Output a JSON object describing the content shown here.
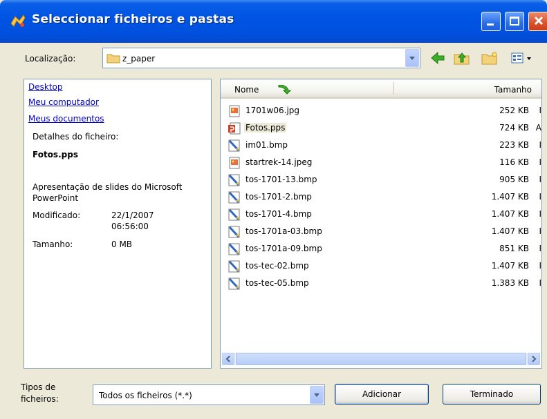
{
  "window": {
    "title": "Seleccionar ficheiros e pastas"
  },
  "location": {
    "label": "Localização:",
    "value": "z_paper"
  },
  "left_panel": {
    "places": [
      "Desktop",
      "Meu computador",
      "Meus documentos"
    ],
    "details_heading": "Detalhes do ficheiro:",
    "file_name": "Fotos.pps",
    "file_type": "Apresentação de slides do Microsoft PowerPoint",
    "modified_label": "Modificado:",
    "modified_date": "22/1/2007",
    "modified_time": "06:56:00",
    "size_label": "Tamanho:",
    "size_value": "0 MB"
  },
  "file_list": {
    "col_name": "Nome",
    "col_size": "Tamanho",
    "files": [
      {
        "name": "1701w06.jpg",
        "size": "252 KB",
        "icon": "image-file-icon",
        "trunc": "I"
      },
      {
        "name": "Fotos.pps",
        "size": "724 KB",
        "icon": "powerpoint-file-icon",
        "trunc": "A"
      },
      {
        "name": "im01.bmp",
        "size": "223 KB",
        "icon": "bitmap-file-icon",
        "trunc": "I"
      },
      {
        "name": "startrek-14.jpeg",
        "size": "116 KB",
        "icon": "image-file-icon",
        "trunc": "I"
      },
      {
        "name": "tos-1701-13.bmp",
        "size": "905 KB",
        "icon": "bitmap-file-icon",
        "trunc": "I"
      },
      {
        "name": "tos-1701-2.bmp",
        "size": "1.407 KB",
        "icon": "bitmap-file-icon",
        "trunc": "I"
      },
      {
        "name": "tos-1701-4.bmp",
        "size": "1.407 KB",
        "icon": "bitmap-file-icon",
        "trunc": "I"
      },
      {
        "name": "tos-1701a-03.bmp",
        "size": "1.407 KB",
        "icon": "bitmap-file-icon",
        "trunc": "I"
      },
      {
        "name": "tos-1701a-09.bmp",
        "size": "851 KB",
        "icon": "bitmap-file-icon",
        "trunc": "I"
      },
      {
        "name": "tos-tec-02.bmp",
        "size": "1.407 KB",
        "icon": "bitmap-file-icon",
        "trunc": "I"
      },
      {
        "name": "tos-tec-05.bmp",
        "size": "1.383 KB",
        "icon": "bitmap-file-icon",
        "trunc": "I"
      }
    ],
    "selected": "Fotos.pps"
  },
  "bottom": {
    "types_label_line1": "Tipos de",
    "types_label_line2": "ficheiros:",
    "types_value": "Todos os ficheiros (*.*)",
    "add_button": "Adicionar",
    "done_button": "Terminado"
  },
  "colors": {
    "titlebar": "#0054e3",
    "face": "#ece9d8",
    "link": "#0000cc",
    "close_button": "#d8522c"
  }
}
